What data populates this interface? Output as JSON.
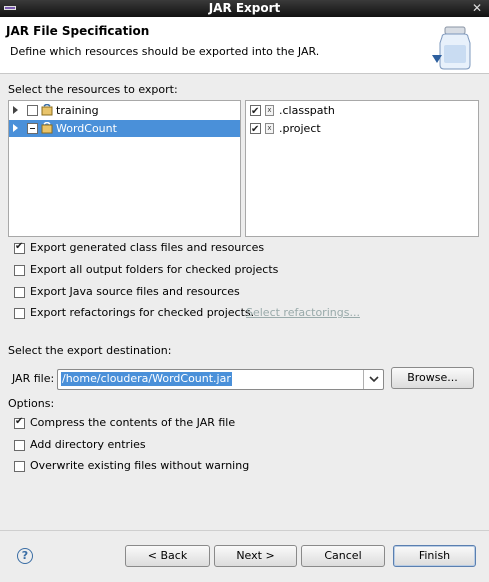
{
  "window": {
    "title": "JAR Export"
  },
  "header": {
    "title": "JAR File Specification",
    "description": "Define which resources should be exported into the JAR."
  },
  "resources": {
    "label": "Select the resources to export:",
    "tree": [
      {
        "label": "training",
        "checked": false
      },
      {
        "label": "WordCount",
        "checked": "partial",
        "selected": true
      }
    ],
    "files": [
      {
        "label": ".classpath",
        "checked": true
      },
      {
        "label": ".project",
        "checked": true
      }
    ]
  },
  "export_options": [
    {
      "label": "Export generated class files and resources",
      "checked": true
    },
    {
      "label": "Export all output folders for checked projects",
      "checked": false
    },
    {
      "label": "Export Java source files and resources",
      "checked": false
    },
    {
      "label": "Export refactorings for checked projects.",
      "checked": false,
      "link": "Select refactorings..."
    }
  ],
  "destination": {
    "label": "Select the export destination:",
    "jar_label": "JAR file:",
    "jar_value": "/home/cloudera/WordCount.jar",
    "browse_label": "Browse..."
  },
  "options": {
    "label": "Options:",
    "items": [
      {
        "label": "Compress the contents of the JAR file",
        "checked": true
      },
      {
        "label": "Add directory entries",
        "checked": false
      },
      {
        "label": "Overwrite existing files without warning",
        "checked": false
      }
    ]
  },
  "buttons": {
    "help": "?",
    "back": "< Back",
    "next": "Next >",
    "cancel": "Cancel",
    "finish": "Finish"
  }
}
